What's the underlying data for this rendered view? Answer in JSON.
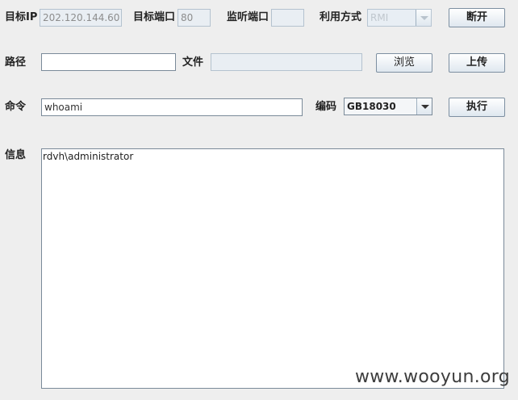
{
  "row1": {
    "target_ip_label": "目标IP",
    "target_ip_value": "202.120.144.60",
    "target_port_label": "目标端口",
    "target_port_value": "80",
    "listen_port_label": "监听端口",
    "listen_port_value": "",
    "method_label": "利用方式",
    "method_value": "RMI",
    "disconnect_button": "断开"
  },
  "row2": {
    "path_label": "路径",
    "path_value": "",
    "file_label": "文件",
    "file_value": "",
    "browse_button": "浏览",
    "upload_button": "上传"
  },
  "row3": {
    "command_label": "命令",
    "command_value": "whoami",
    "encoding_label": "编码",
    "encoding_value": "GB18030",
    "execute_button": "执行"
  },
  "info": {
    "label": "信息",
    "output": "rdvh\\administrator"
  },
  "watermark": "www.wooyun.org"
}
